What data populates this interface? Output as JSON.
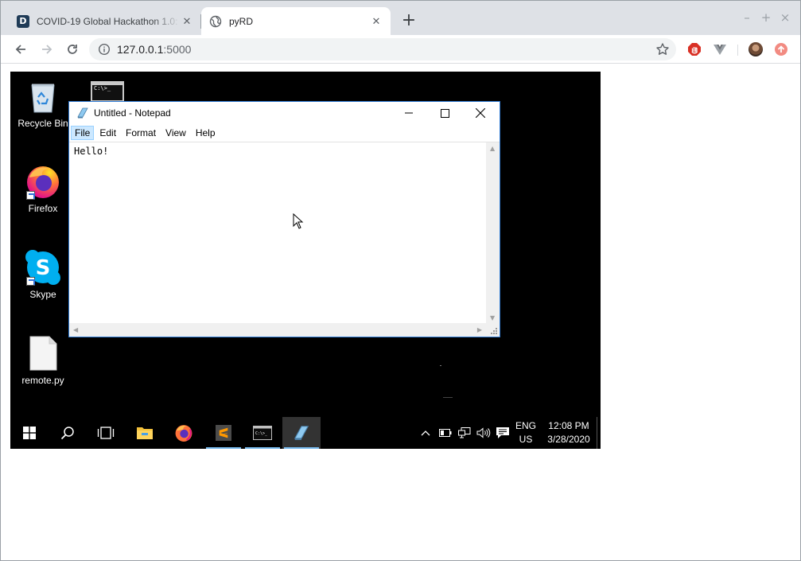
{
  "browser": {
    "tabs": [
      {
        "title": "COVID-19 Global Hackathon 1.0: ",
        "favicon": "devpost-icon",
        "active": false
      },
      {
        "title": "pyRD",
        "favicon": "globe-icon",
        "active": true
      }
    ],
    "address": {
      "host": "127.0.0.1",
      "port": ":5000"
    },
    "window_controls": [
      "–",
      "+",
      "×"
    ]
  },
  "desktop": {
    "icons": [
      {
        "label": "Recycle Bin",
        "icon": "recycle-bin-icon"
      },
      {
        "label": "Firefox",
        "icon": "firefox-icon"
      },
      {
        "label": "Skype",
        "icon": "skype-icon"
      },
      {
        "label": "remote.py",
        "icon": "file-icon"
      }
    ],
    "cmd_glyph": "C:\\>_"
  },
  "notepad": {
    "title": "Untitled - Notepad",
    "menu": [
      "File",
      "Edit",
      "Format",
      "View",
      "Help"
    ],
    "selected_menu": "File",
    "content": "Hello!"
  },
  "taskbar": {
    "language": "ENG",
    "region": "US",
    "time": "12:08 PM",
    "date": "3/28/2020",
    "accent": "#76b9ed"
  }
}
